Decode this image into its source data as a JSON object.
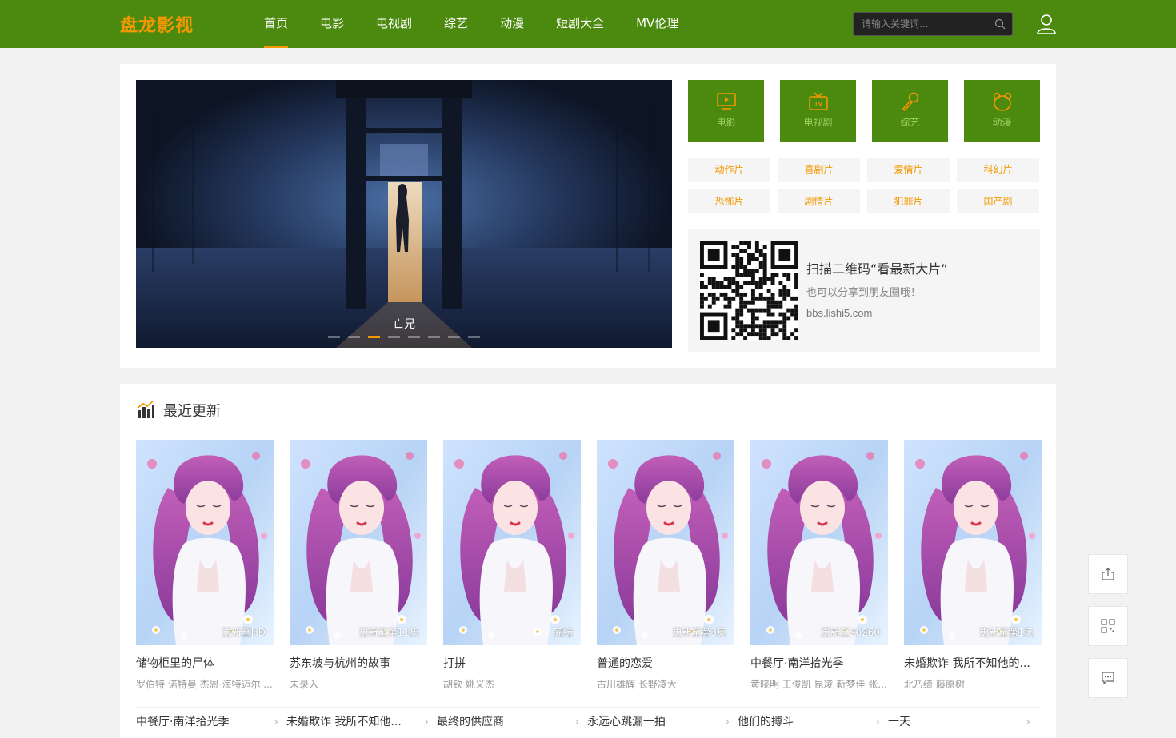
{
  "header": {
    "logo": "盘龙影视",
    "nav": [
      "首页",
      "电影",
      "电视剧",
      "综艺",
      "动漫",
      "短剧大全",
      "MV伦理"
    ],
    "search_placeholder": "请输入关键词..."
  },
  "banner": {
    "caption": "亡兄",
    "dots_count": 8,
    "active_dot": 2
  },
  "categories": [
    {
      "label": "电影",
      "icon": "play-screen-icon"
    },
    {
      "label": "电视剧",
      "icon": "tv-icon"
    },
    {
      "label": "综艺",
      "icon": "microphone-icon"
    },
    {
      "label": "动漫",
      "icon": "bear-face-icon"
    }
  ],
  "genres": [
    "动作片",
    "喜剧片",
    "爱情片",
    "科幻片",
    "恐怖片",
    "剧情片",
    "犯罪片",
    "国产剧"
  ],
  "qr": {
    "title": "扫描二维码“看最新大片”",
    "subtitle": "也可以分享到朋友圈哦！",
    "url": "bbs.lishi5.com"
  },
  "latest": {
    "title": "最近更新",
    "cards": [
      {
        "title": "储物柜里的尸体",
        "cast": "罗伯特·诺特曼 杰恩·海特迈尔 ...",
        "badge": "更新至HD"
      },
      {
        "title": "苏东坡与杭州的故事",
        "cast": "未录入",
        "badge": "更新至第11集"
      },
      {
        "title": "打拼",
        "cast": "胡钦 姚义杰",
        "badge": "完结"
      },
      {
        "title": "普通的恋爱",
        "cast": "古川雄辉 长野凌大",
        "badge": "更新至第3集"
      },
      {
        "title": "中餐厅·南洋拾光季",
        "cast": "黄晓明 王俊凯 昆凌 靳梦佳 张...",
        "badge": "更新至20260"
      },
      {
        "title": "未婚欺诈 我所不知他的...",
        "cast": "北乃绮 藤原树",
        "badge": "更新至第1集"
      }
    ],
    "list": [
      "中餐厅·南洋拾光季",
      "未婚欺诈 我所不知他...",
      "最终的供应商",
      "永远心跳漏一拍",
      "他们的搏斗",
      "一天"
    ]
  },
  "tools": [
    "share-icon",
    "qrcode-icon",
    "feedback-icon"
  ],
  "colors": {
    "primary": "#4c8a0f",
    "accent": "#f39800"
  }
}
